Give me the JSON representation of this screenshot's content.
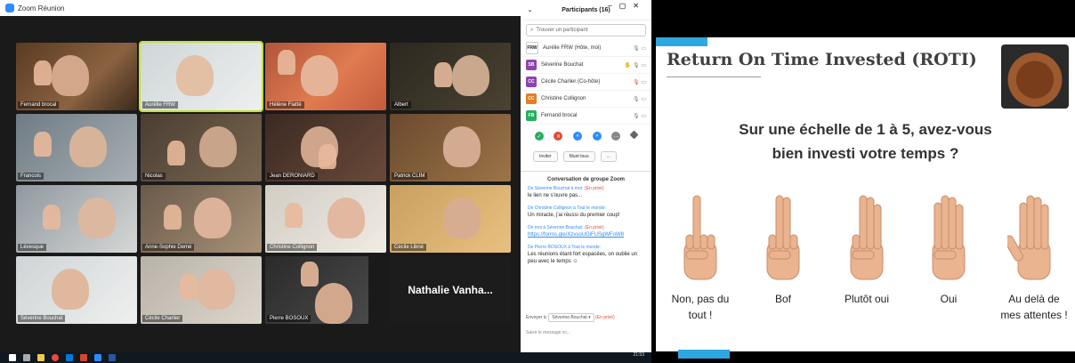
{
  "zoom": {
    "window_title": "Zoom Réunion",
    "tiles": [
      {
        "name": "Fernand brocal"
      },
      {
        "name": "Aurélie FRW"
      },
      {
        "name": "Hélène Flatté"
      },
      {
        "name": "Albert"
      },
      {
        "name": "Francois"
      },
      {
        "name": "Nicolas"
      },
      {
        "name": "Jean DERONIARD"
      },
      {
        "name": "Patrick CLIM"
      },
      {
        "name": "Lévesque"
      },
      {
        "name": "Anne-Sophie Demé"
      },
      {
        "name": "Christine Collignon"
      },
      {
        "name": "Cécile Libné"
      },
      {
        "name": "Séverine Bouchat"
      },
      {
        "name": "Cécile Charlier"
      },
      {
        "name": "Pierre BOSOUX"
      },
      {
        "name": "Nathalie Vanha..."
      }
    ]
  },
  "participants": {
    "title": "Participants (16)",
    "search_placeholder": "Trouver un participant",
    "list": [
      {
        "initials": "FRW",
        "name": "Aurélie FRW (Hôte, moi)",
        "color": "#ffffff"
      },
      {
        "initials": "SB",
        "name": "Séverine Bouchat",
        "color": "#8e44ad"
      },
      {
        "initials": "CC",
        "name": "Cécile Charlier (Co-hôte)",
        "color": "#8e44ad"
      },
      {
        "initials": "CC",
        "name": "Christine Collignon",
        "color": "#e67e22"
      },
      {
        "initials": "FB",
        "name": "Fernand brocal",
        "color": "#27ae60"
      }
    ],
    "buttons": {
      "invite": "Inviter",
      "mute_all": "Muet tous",
      "more": "..."
    }
  },
  "chat": {
    "title": "Conversation de groupe Zoom",
    "messages": [
      {
        "from": "De Séverine Bouchat à moi:",
        "private": "(En privé)",
        "text": "le lien ne s'ouvre pas..."
      },
      {
        "from": "De Christine Collignon à Tout le monde:",
        "private": "",
        "text": "Un miracle, j'ai réussi du premier coup!"
      },
      {
        "from": "De moi à Séverine Bouchat:",
        "private": "(En privé)",
        "text": "https://forms.gle/XzvsoUGiFUSgWFoW8"
      },
      {
        "from": "De Pierre BOSOUX à Tout le monde:",
        "private": "",
        "text": "Les réunions étant fort espacées, on oublie un peu avec le temps ☺"
      }
    ],
    "send_to_label": "Envoyer à:",
    "send_to_value": "Séverine Bouchat ▾",
    "send_to_private": "(En privé)",
    "input_placeholder": "Saisir le message ici..."
  },
  "taskbar": {
    "time": "21:53"
  },
  "slide": {
    "title": "Return On Time Invested (ROTI)",
    "question_line1": "Sur une échelle de 1 à 5, avez-vous",
    "question_line2": "bien investi votre temps ?",
    "scale": [
      {
        "label": "Non, pas du tout !",
        "fingers": 1
      },
      {
        "label": "Bof",
        "fingers": 2
      },
      {
        "label": "Plutôt oui",
        "fingers": 3
      },
      {
        "label": "Oui",
        "fingers": 4
      },
      {
        "label": "Au delà de mes attentes !",
        "fingers": 5
      }
    ]
  }
}
